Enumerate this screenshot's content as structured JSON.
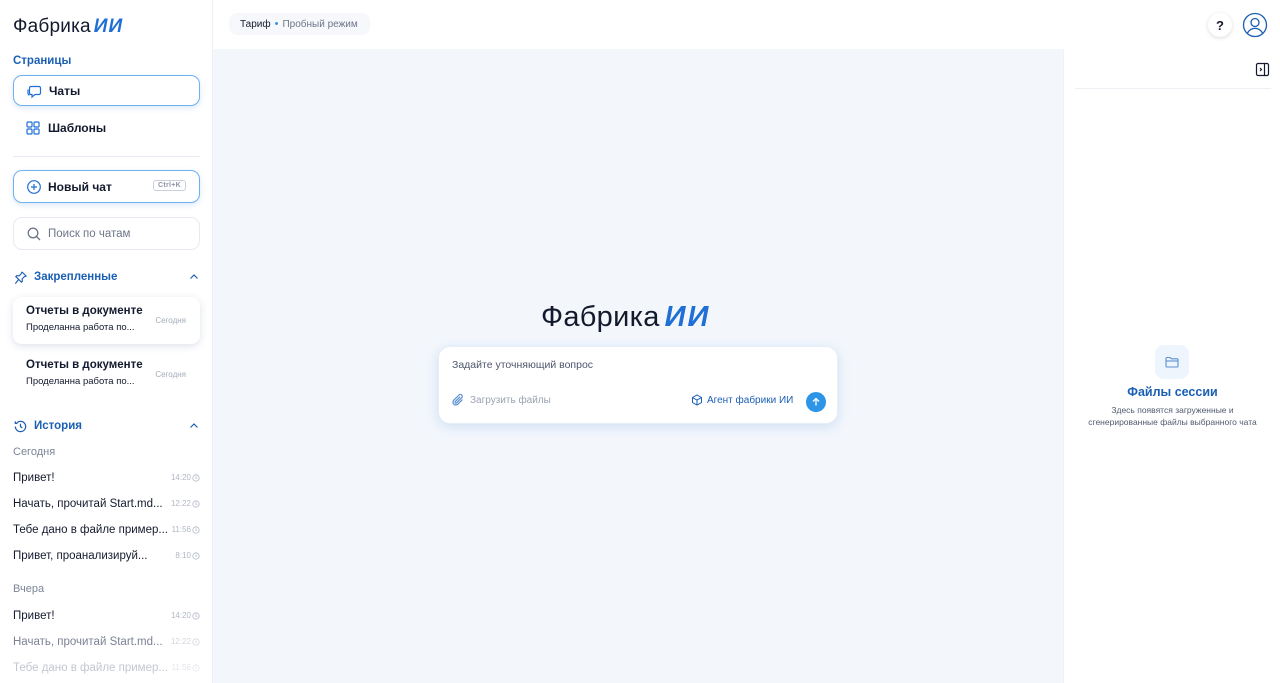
{
  "app": {
    "logo_text": "Фабрика",
    "logo_accent": "ИИ"
  },
  "sidebar": {
    "pages_label": "Страницы",
    "nav": [
      {
        "label": "Чаты",
        "icon": "chat-icon",
        "active": true
      },
      {
        "label": "Шаблоны",
        "icon": "grid-icon",
        "active": false
      }
    ],
    "new_chat_label": "Новый чат",
    "new_chat_shortcut": "Ctrl+K",
    "search_placeholder": "Поиск по чатам",
    "pinned": {
      "label": "Закрепленные",
      "items": [
        {
          "title": "Отчеты в документе",
          "subtitle": "Проделанна работа по...",
          "date": "Сегодня",
          "active": true
        },
        {
          "title": "Отчеты в документе",
          "subtitle": "Проделанна работа по...",
          "date": "Сегодня",
          "active": false
        }
      ]
    },
    "history": {
      "label": "История",
      "today_label": "Сегодня",
      "today": [
        {
          "title": "Привет!",
          "time": "14:20"
        },
        {
          "title": "Начать, прочитай Start.md...",
          "time": "12:22"
        },
        {
          "title": "Тебе дано в файле пример...",
          "time": "11:56"
        },
        {
          "title": "Привет, проанализируй...",
          "time": "8:10"
        }
      ],
      "yesterday_label": "Вчера",
      "yesterday": [
        {
          "title": "Привет!",
          "time": "14:20"
        },
        {
          "title": "Начать, прочитай Start.md...",
          "time": "12:22"
        },
        {
          "title": "Тебе дано в файле пример...",
          "time": "11:56"
        }
      ]
    }
  },
  "topbar": {
    "tariff_label": "Тариф",
    "tariff_separator": "•",
    "tariff_mode": "Пробный режим",
    "help_label": "?"
  },
  "main": {
    "logo_text": "Фабрика",
    "logo_accent": "ИИ",
    "prompt_placeholder": "Задайте уточняющий вопрос",
    "upload_label": "Загрузить файлы",
    "agent_label": "Агент фабрики ИИ"
  },
  "right_panel": {
    "files_title": "Файлы сессии",
    "files_desc": "Здесь появятся загруженные и сгенерированные файлы выбранного чата"
  },
  "colors": {
    "accent": "#1f6fd6",
    "section_blue": "#1a5fb4",
    "send_button": "#2e95e6",
    "background": "#f3f7fc"
  }
}
